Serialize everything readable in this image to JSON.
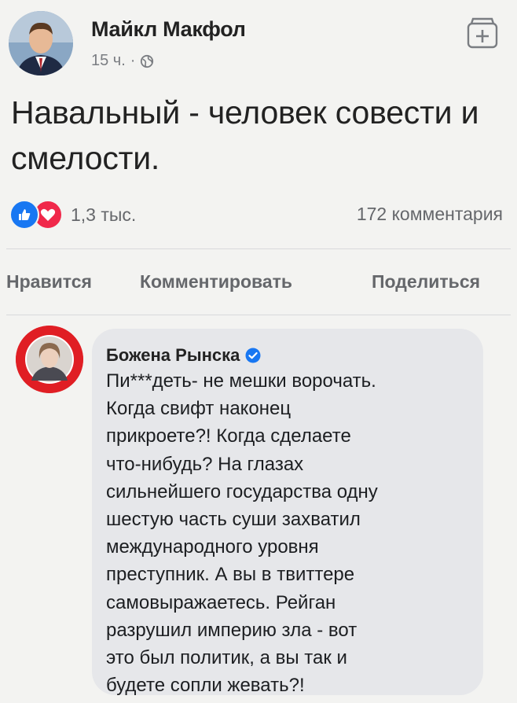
{
  "post": {
    "author": "Майкл Макфол",
    "time": "15 ч.",
    "dot": "·",
    "text": "Навальный - человек совести и смелости.",
    "reactions_count": "1,3 тыс.",
    "comments_count": "172 комментария"
  },
  "actions": {
    "like": "Нравится",
    "comment": "Комментировать",
    "share": "Поделиться"
  },
  "comment": {
    "author": "Божена Рынска",
    "text": "Пи***деть- не мешки ворочать.\nКогда свифт наконец\nприкроете?! Когда сделаете\nчто-нибудь? На глазах\nсильнейшего государства одну\nшестую часть суши захватил\nмеждународного уровня\nпреступник. А вы в твиттере\nсамовыражаетесь. Рейган\nразрушил империю зла - вот\nэто был политик, а вы так и\nбудете сопли жевать?!"
  },
  "icons": {
    "globe": "globe-icon",
    "save": "save-post-icon",
    "like": "like-reaction-icon",
    "love": "love-reaction-icon",
    "verified": "verified-badge-icon"
  },
  "colors": {
    "like_blue": "#1877f2",
    "love_red": "#f0284a",
    "avatar_ring_red": "#e01e24"
  }
}
